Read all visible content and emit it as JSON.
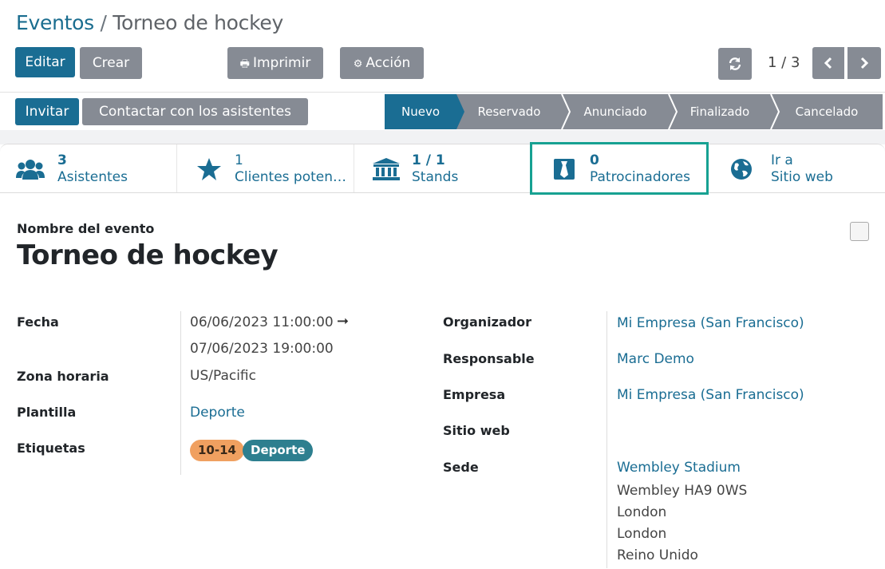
{
  "breadcrumb": {
    "parent": "Eventos",
    "separator": "/",
    "current": "Torneo de hockey"
  },
  "header": {
    "edit_label": "Editar",
    "create_label": "Crear",
    "print_label": "Imprimir",
    "action_label": "Acción",
    "pager": "1 / 3"
  },
  "toolbar": {
    "invite_label": "Invitar",
    "contact_label": "Contactar con los asistentes"
  },
  "stages": [
    {
      "label": "Nuevo",
      "active": true
    },
    {
      "label": "Reservado",
      "active": false
    },
    {
      "label": "Anunciado",
      "active": false
    },
    {
      "label": "Finalizado",
      "active": false
    },
    {
      "label": "Cancelado",
      "active": false
    }
  ],
  "smart_buttons": [
    {
      "value": "3",
      "label": "Asistentes",
      "icon": "users-icon"
    },
    {
      "value": "1",
      "label": "Clientes poten…",
      "icon": "star-icon"
    },
    {
      "value": "1 / 1",
      "label": "Stands",
      "icon": "bank-icon"
    },
    {
      "value": "0",
      "label": "Patrocinadores",
      "icon": "sponsor-icon"
    },
    {
      "value": "Ir a",
      "label": "Sitio web",
      "icon": "globe-icon"
    }
  ],
  "form": {
    "title_label": "Nombre del evento",
    "title": "Torneo de hockey",
    "left": {
      "date_label": "Fecha",
      "date_start": "06/06/2023 11:00:00",
      "date_arrow": "➞",
      "date_end": "07/06/2023 19:00:00",
      "tz_label": "Zona horaria",
      "tz_value": "US/Pacific",
      "template_label": "Plantilla",
      "template_value": "Deporte",
      "tags_label": "Etiquetas",
      "tags": [
        {
          "label": "10-14",
          "color": "#f0a060"
        },
        {
          "label": "Deporte",
          "color": "#2d7f8f"
        }
      ]
    },
    "right": {
      "organizer_label": "Organizador",
      "organizer_value": "Mi Empresa (San Francisco)",
      "responsible_label": "Responsable",
      "responsible_value": "Marc Demo",
      "company_label": "Empresa",
      "company_value": "Mi Empresa (San Francisco)",
      "website_label": "Sitio web",
      "venue_label": "Sede",
      "venue_name": "Wembley Stadium",
      "venue_line1": "Wembley HA9 0WS",
      "venue_line2": "London",
      "venue_line3": "London",
      "venue_line4": "Reino Unido"
    }
  },
  "colors": {
    "primary": "#1a6d93",
    "secondary": "#868b94",
    "highlight": "#17a192",
    "link": "#1a6d93"
  }
}
